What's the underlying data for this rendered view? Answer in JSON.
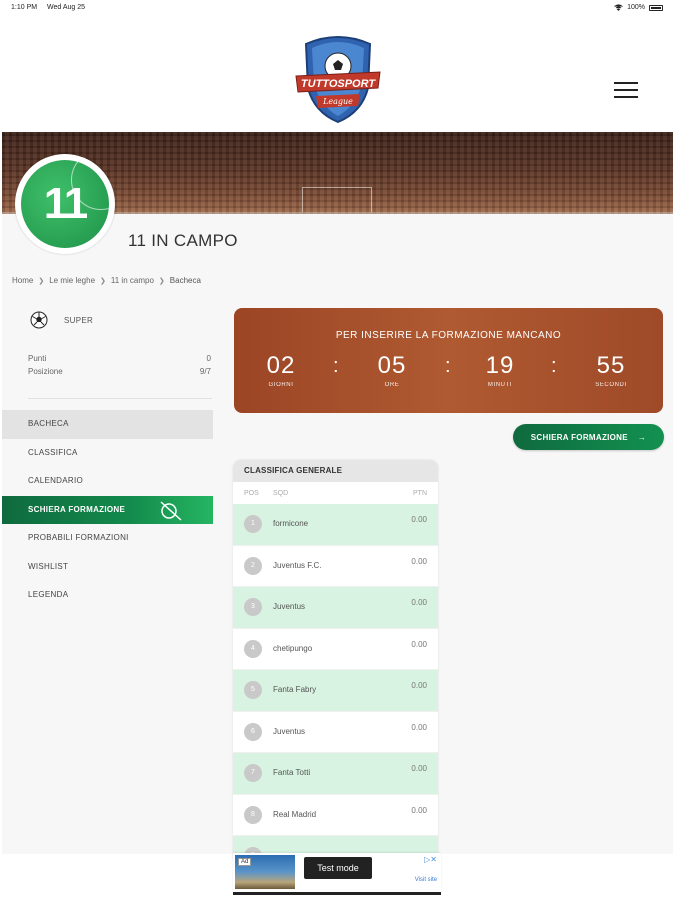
{
  "status_bar": {
    "time": "1:10 PM",
    "date": "Wed Aug 25",
    "battery": "100%"
  },
  "header": {
    "logo_text_top": "TUTTOSPORT",
    "logo_text_bottom": "League"
  },
  "league": {
    "badge_number": "11",
    "title": "11 IN CAMPO"
  },
  "breadcrumb": [
    "Home",
    "Le mie leghe",
    "11 in campo",
    "Bacheca"
  ],
  "team": {
    "name": "SUPER"
  },
  "stats": [
    {
      "label": "Punti",
      "value": "0"
    },
    {
      "label": "Posizione",
      "value": "9/7"
    }
  ],
  "side_menu": [
    "BACHECA",
    "CLASSIFICA",
    "CALENDARIO",
    "SCHIERA FORMAZIONE",
    "PROBABILI FORMAZIONI",
    "WISHLIST",
    "LEGENDA"
  ],
  "countdown": {
    "title": "PER INSERIRE LA FORMAZIONE MANCANO",
    "units": [
      {
        "value": "02",
        "label": "GIORNI"
      },
      {
        "value": "05",
        "label": "ORE"
      },
      {
        "value": "19",
        "label": "MINUTI"
      },
      {
        "value": "55",
        "label": "SECONDI"
      }
    ],
    "separator": ":"
  },
  "schiera_button": {
    "label": "SCHIERA FORMAZIONE",
    "arrow": "→"
  },
  "standings": {
    "title": "CLASSIFICA GENERALE",
    "headers": {
      "pos": "POS",
      "sqd": "SQD",
      "ptn": "PTN"
    },
    "rows": [
      {
        "pos": "1",
        "team": "formicone",
        "pts": "0.00"
      },
      {
        "pos": "2",
        "team": "Juventus F.C.",
        "pts": "0.00"
      },
      {
        "pos": "3",
        "team": "Juventus",
        "pts": "0.00"
      },
      {
        "pos": "4",
        "team": "chetipungo",
        "pts": "0.00"
      },
      {
        "pos": "5",
        "team": "Fanta Fabry",
        "pts": "0.00"
      },
      {
        "pos": "6",
        "team": "Juventus",
        "pts": "0.00"
      },
      {
        "pos": "7",
        "team": "Fanta Totti",
        "pts": "0.00"
      },
      {
        "pos": "8",
        "team": "Real Madrid",
        "pts": "0.00"
      },
      {
        "pos": "9",
        "team": "",
        "pts": ""
      }
    ]
  },
  "ad": {
    "badge": "Ad",
    "test_label": "Test mode",
    "visit": "Visit site",
    "choice": "▷✕"
  },
  "colors": {
    "green": "#138a4c",
    "countdown": "#a94f2b",
    "row_highlight": "#d8f3e1"
  }
}
